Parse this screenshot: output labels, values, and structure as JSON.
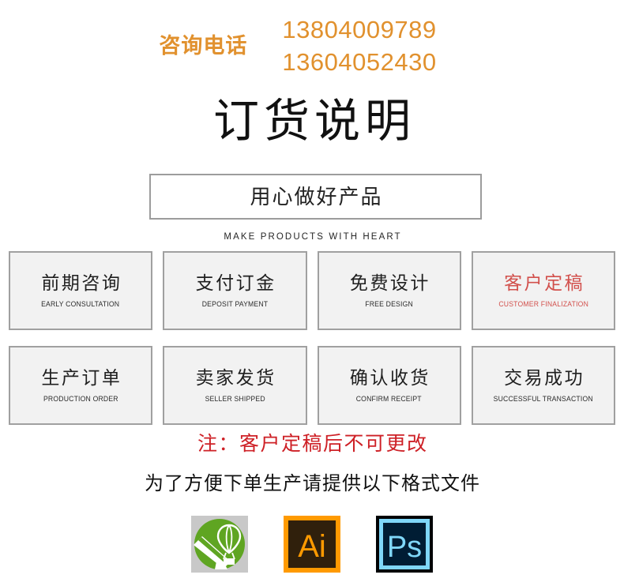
{
  "header": {
    "contact_label": "咨询电话",
    "phones": [
      "13804009789",
      "13604052430"
    ],
    "accent_color": "#E1912E"
  },
  "title": {
    "main": "订货说明",
    "slogan_cn": "用心做好产品",
    "slogan_en": "MAKE PRODUCTS WITH HEART"
  },
  "steps": [
    {
      "cn": "前期咨询",
      "en": "EARLY CONSULTATION",
      "highlight": false
    },
    {
      "cn": "支付订金",
      "en": "DEPOSIT PAYMENT",
      "highlight": false
    },
    {
      "cn": "免费设计",
      "en": "FREE DESIGN",
      "highlight": false
    },
    {
      "cn": "客户定稿",
      "en": "CUSTOMER FINALIZATION",
      "highlight": true
    },
    {
      "cn": "生产订单",
      "en": "PRODUCTION ORDER",
      "highlight": false
    },
    {
      "cn": "卖家发货",
      "en": "SELLER SHIPPED",
      "highlight": false
    },
    {
      "cn": "确认收货",
      "en": "CONFIRM RECEIPT",
      "highlight": false
    },
    {
      "cn": "交易成功",
      "en": "SUCCESSFUL TRANSACTION",
      "highlight": false
    }
  ],
  "notes": {
    "warning": "注：客户定稿后不可更改",
    "warning_color": "#CE2026",
    "formats_hint": "为了方便下单生产请提供以下格式文件"
  },
  "format_icons": [
    {
      "name": "coreldraw-icon",
      "label": "CorelDRAW",
      "bg": "#c8c8c8",
      "fg": "#5FA522"
    },
    {
      "name": "illustrator-icon",
      "label": "Ai",
      "bg": "#30200C",
      "fg": "#FF9A00",
      "border": "#FF9A00"
    },
    {
      "name": "photoshop-icon",
      "label": "Ps",
      "bg": "#001D34",
      "fg": "#7FD7F9",
      "border": "#7FD7F9"
    }
  ],
  "palette": {
    "box_border": "#a0a0a0",
    "box_fill": "#f2f2f2",
    "highlight_red": "#D2504C"
  }
}
